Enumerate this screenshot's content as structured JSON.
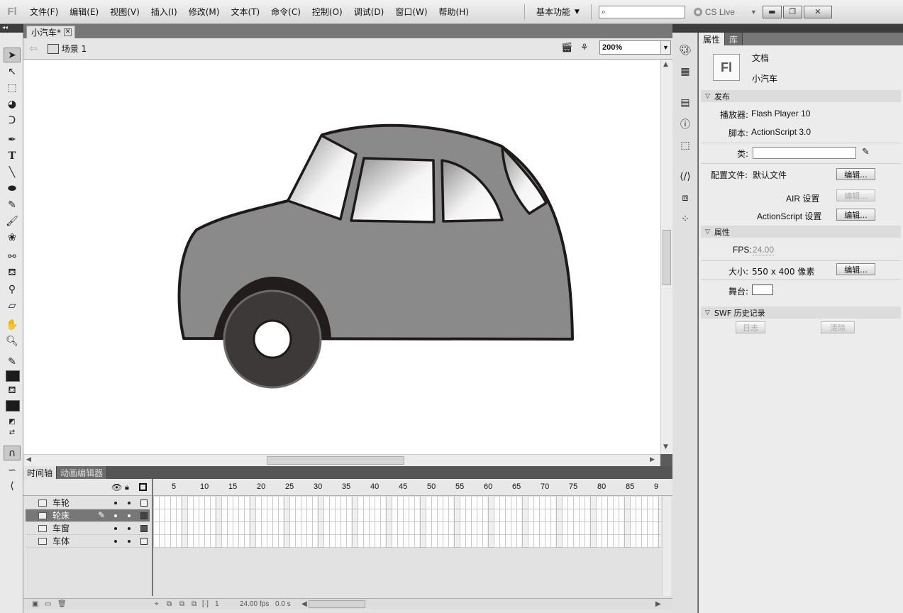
{
  "menubar": {
    "logo": "Fl",
    "items": [
      "文件(F)",
      "编辑(E)",
      "视图(V)",
      "插入(I)",
      "修改(M)",
      "文本(T)",
      "命令(C)",
      "控制(O)",
      "调试(D)",
      "窗口(W)",
      "帮助(H)"
    ],
    "workspace": "基本功能",
    "search_placeholder": "",
    "cs_live": "CS Live"
  },
  "document": {
    "tab_title": "小汽车*",
    "scene": "场景 1",
    "zoom": "200%"
  },
  "timeline": {
    "tabs": [
      "时间轴",
      "动画编辑器"
    ],
    "frame_numbers": [
      "5",
      "10",
      "15",
      "20",
      "25",
      "30",
      "35",
      "40",
      "45",
      "50",
      "55",
      "60",
      "65",
      "70",
      "75",
      "80",
      "85",
      "9"
    ],
    "layers": [
      {
        "name": "车轮",
        "selected": false
      },
      {
        "name": "轮床",
        "selected": true
      },
      {
        "name": "车窗",
        "selected": false
      },
      {
        "name": "车体",
        "selected": false
      }
    ],
    "current_frame": "1",
    "fps": "24.00",
    "fps_unit": "fps",
    "time": "0.0 s"
  },
  "properties": {
    "tabs": [
      "属性",
      "库"
    ],
    "badge": "Fl",
    "doc_type": "文档",
    "doc_name": "小汽车",
    "publish_section": "发布",
    "player_label": "播放器:",
    "player_value": "Flash Player 10",
    "script_label": "脚本:",
    "script_value": "ActionScript 3.0",
    "class_label": "类:",
    "profile_label": "配置文件:",
    "profile_value": "默认文件",
    "edit_label": "编辑...",
    "air_label": "AIR 设置",
    "as_label": "ActionScript 设置",
    "props_section": "属性",
    "fps_label": "FPS:",
    "fps_value": "24.00",
    "size_label": "大小:",
    "size_value": "550 x 400 像素",
    "stage_label": "舞台:",
    "swf_section": "SWF 历史记录",
    "log_btn": "日志",
    "clear_btn": "清除"
  },
  "colors": {
    "car_body": "#8a8a8a",
    "outline": "#1f1a1a",
    "wheel": "#3d3939",
    "wheel_rim": "#6a6a6a"
  }
}
